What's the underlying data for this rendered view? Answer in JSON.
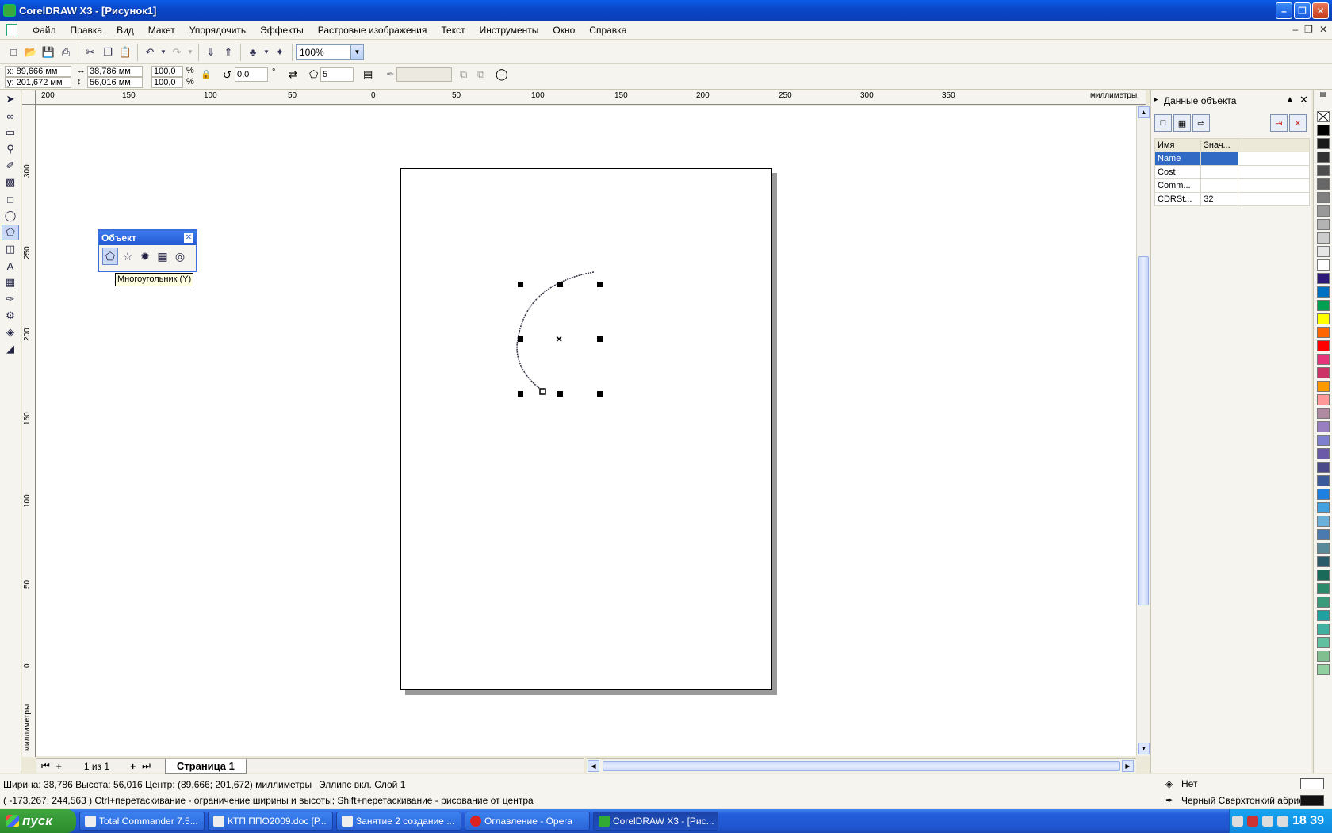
{
  "window": {
    "title": "CorelDRAW X3 - [Рисунок1]"
  },
  "menu": [
    {
      "label": "Файл",
      "name": "menu-file"
    },
    {
      "label": "Правка",
      "name": "menu-edit"
    },
    {
      "label": "Вид",
      "name": "menu-view"
    },
    {
      "label": "Макет",
      "name": "menu-layout"
    },
    {
      "label": "Упорядочить",
      "name": "menu-arrange"
    },
    {
      "label": "Эффекты",
      "name": "menu-effects"
    },
    {
      "label": "Растровые изображения",
      "name": "menu-bitmaps"
    },
    {
      "label": "Текст",
      "name": "menu-text"
    },
    {
      "label": "Инструменты",
      "name": "menu-tools"
    },
    {
      "label": "Окно",
      "name": "menu-window"
    },
    {
      "label": "Справка",
      "name": "menu-help"
    }
  ],
  "toolbar": {
    "zoom": "100%"
  },
  "property_bar": {
    "x": "x: 89,666 мм",
    "y": "y: 201,672 мм",
    "width": "38,786 мм",
    "height": "56,016 мм",
    "scale_x": "100,0",
    "scale_y": "100,0",
    "percent": "%",
    "rotation": "0,0",
    "degree": "°",
    "sides": "5"
  },
  "ruler": {
    "h_labels": [
      "200",
      "150",
      "100",
      "50",
      "0",
      "50",
      "100",
      "150",
      "200",
      "250",
      "300",
      "350"
    ],
    "v_labels": [
      "300",
      "250",
      "200",
      "150",
      "100",
      "50",
      "0"
    ],
    "unit": "миллиметры"
  },
  "object_toolbar": {
    "title": "Объект",
    "tooltip": "Многоугольник (Y)"
  },
  "docker": {
    "title": "Данные объекта",
    "columns": [
      "Имя",
      "Знач..."
    ],
    "rows": [
      {
        "key": "Name",
        "value": ""
      },
      {
        "key": "Cost",
        "value": ""
      },
      {
        "key": "Comm...",
        "value": ""
      },
      {
        "key": "CDRSt...",
        "value": "32"
      }
    ]
  },
  "page_nav": {
    "counter": "1 из 1",
    "tab": "Страница 1"
  },
  "status": {
    "line1": "Ширина: 38,786  Высота: 56,016  Центр: (89,666; 201,672)  миллиметры",
    "object_info": "Эллипс вкл. Слой 1",
    "line2": "( -173,267; 244,563 )   Ctrl+перетаскивание - ограничение ширины и высоты; Shift+перетаскивание - рисование от центра",
    "fill": "Нет",
    "outline": "Черный  Сверхтонкий абрис"
  },
  "colors": {
    "palette": [
      "#000000",
      "#1a1a1a",
      "#333333",
      "#4d4d4d",
      "#666666",
      "#808080",
      "#999999",
      "#b3b3b3",
      "#cccccc",
      "#e6e6e6",
      "#ffffff",
      "#2e1a7a",
      "#0070c0",
      "#00a050",
      "#ffff00",
      "#ff6600",
      "#ff0000",
      "#e6337a",
      "#cc3366",
      "#ff9900",
      "#ff9999",
      "#b08aa0",
      "#9a7fc0",
      "#7f7fd0",
      "#6a5aa8",
      "#4a4a8a",
      "#3a5a9a",
      "#2080e0",
      "#40a0e0",
      "#6ab0d8",
      "#4a7ab0",
      "#5a8a9a",
      "#2a5a6a",
      "#1a6a5a",
      "#2a8a6a",
      "#3a9a7a",
      "#20a0a0",
      "#40b0a0",
      "#60c0a0",
      "#80c090",
      "#90d0a0"
    ]
  },
  "taskbar": {
    "start": "пуск",
    "tasks": [
      "Total Commander 7.5...",
      "КТП ППО2009.doc [Р...",
      "Занятие 2 создание ...",
      "Оглавление - Opera",
      "CorelDRAW X3 - [Рис..."
    ],
    "clock": "18 39"
  }
}
